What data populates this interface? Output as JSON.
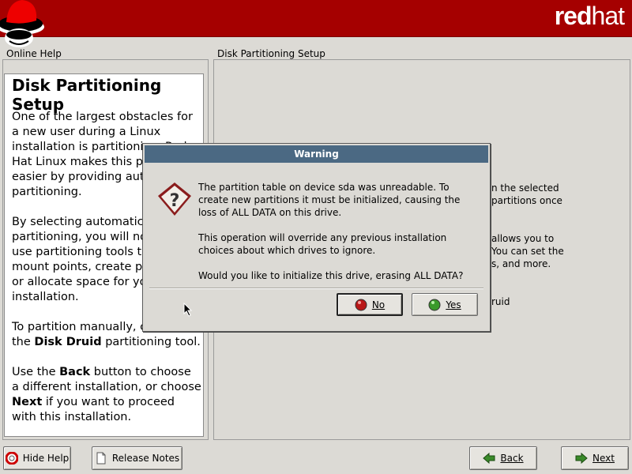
{
  "header": {
    "brand_red": "red",
    "brand_hat": "hat"
  },
  "help_panel": {
    "frame_title": "Online Help",
    "heading": "Disk Partitioning Setup",
    "paragraphs": [
      "One of the largest obstacles for a new user during a Linux installation is partitioning. Red Hat Linux makes this process easier by providing automatic partitioning.",
      "By selecting automatic partitioning, you will not have to use partitioning tools to assign mount points, create partitions, or allocate space for your installation.",
      "To partition manually, choose the Disk Druid partitioning tool.",
      "Use the Back button to choose a different installation, or choose Next if you want to proceed with this installation."
    ],
    "p3": {
      "before": "To partition manually, choose the",
      "bold": "Disk Druid",
      "after": "partitioning tool."
    },
    "p4": {
      "a": "Use the",
      "back": "Back",
      "b": "button to choose a different installation, or choose",
      "next": "Next",
      "c": "if you want to proceed with this installation."
    }
  },
  "main_panel": {
    "frame_title": "Disk Partitioning Setup",
    "visible_fragments": [
      "n the selected",
      "partitions once",
      "allows you to",
      "You can set the",
      "s, and more.",
      "ruid"
    ]
  },
  "dialog": {
    "title": "Warning",
    "message_1": "The partition table on device sda was unreadable. To create new partitions it must be initialized, causing the loss of ALL DATA on this drive.",
    "message_2": "This operation will override any previous installation choices about which drives to ignore.",
    "message_3": "Would you like to initialize this drive, erasing ALL DATA?",
    "no_label": "No",
    "yes_label": "Yes"
  },
  "bottom_bar": {
    "hide_help": "Hide Help",
    "release_notes": "Release Notes",
    "back": "Back",
    "next": "Next"
  },
  "colors": {
    "header_red": "#a50000",
    "title_bar": "#4b6983",
    "background": "#dcdad5"
  }
}
